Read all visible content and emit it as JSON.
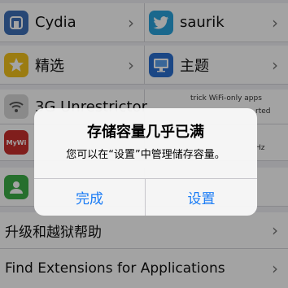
{
  "grid": {
    "row1": {
      "left": {
        "label": "Cydia",
        "icon": "cydia-icon"
      },
      "right": {
        "label": "saurik",
        "icon": "twitter-bird-icon"
      }
    },
    "row2": {
      "left": {
        "label": "精选",
        "icon": "star-icon"
      },
      "right": {
        "label": "主题",
        "icon": "monitor-icon"
      }
    },
    "row3": {
      "left": {
        "label": "3G Unrestrictor",
        "icon": "wifi-icon"
      },
      "right": {
        "line1": "trick WiFi-only apps",
        "line2": "rted",
        "line3": "Hz"
      }
    },
    "row4": {
      "left": {
        "icon": "mywi-icon",
        "icon_text": "MyWi"
      }
    },
    "row5": {
      "left": {
        "icon": "contact-icon"
      }
    }
  },
  "list": {
    "upgrade_help": "升级和越狱帮助",
    "find_extensions": "Find Extensions for Applications"
  },
  "alert": {
    "title": "存储容量几乎已满",
    "message": "您可以在“设置”中管理储存容量。",
    "done_button": "完成",
    "settings_button": "设置"
  },
  "colors": {
    "accent_blue": "#1a7cf5",
    "cydia_blue": "#3d6fb8",
    "twitter_blue": "#2aa3dd",
    "star_yellow": "#f2c21b",
    "monitor_blue": "#2b6fd0",
    "contact_green": "#3cae47"
  },
  "chevron_glyph": "›"
}
